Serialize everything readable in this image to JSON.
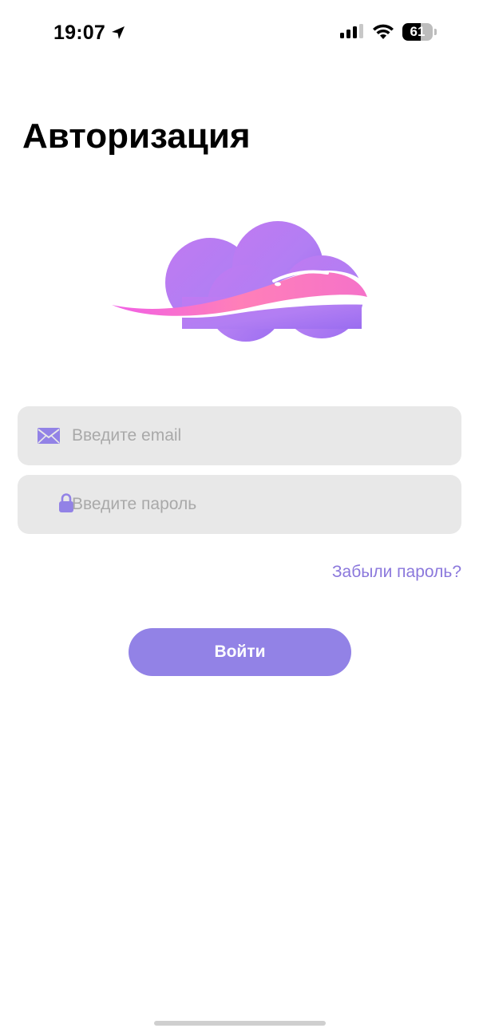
{
  "status_bar": {
    "time": "19:07",
    "battery_level": "61",
    "battery_fraction": 0.61
  },
  "page": {
    "title": "Авторизация"
  },
  "form": {
    "email_placeholder": "Введите email",
    "email_value": "",
    "password_placeholder": "Введите пароль",
    "password_value": "",
    "forgot_password": "Забыли пароль?",
    "submit_label": "Войти"
  },
  "icons": {
    "location": "location-arrow-icon",
    "signal": "cellular-signal-icon",
    "wifi": "wifi-icon",
    "battery": "battery-icon",
    "email": "envelope-icon",
    "password": "lock-icon"
  },
  "colors": {
    "accent": "#9282e6",
    "link": "#8b78dc",
    "field_background": "#e8e8e8",
    "placeholder": "#a9a9a9"
  }
}
